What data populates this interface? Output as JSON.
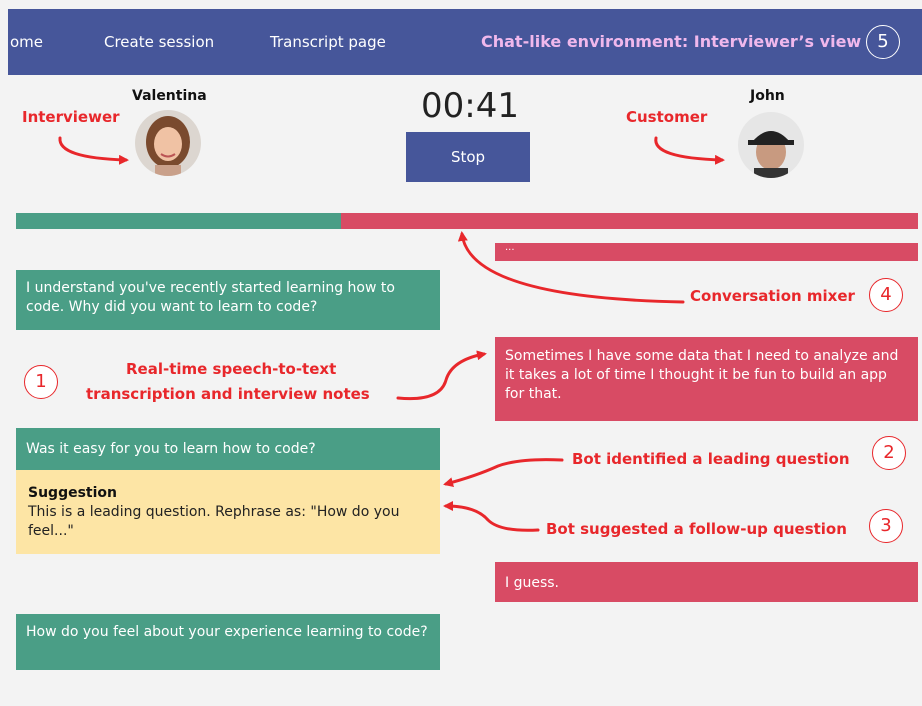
{
  "nav": {
    "items": [
      "ome",
      "Create session",
      "Transcript page"
    ],
    "title": "Chat-like environment: Interviewer’s view",
    "badge": "5"
  },
  "session": {
    "timer": "00:41",
    "stop_label": "Stop",
    "interviewer_name": "Valentina",
    "customer_name": "John"
  },
  "annotations": {
    "interviewer": "Interviewer",
    "customer": "Customer",
    "mixer": "Conversation mixer",
    "mixer_num": "4",
    "transcription_line1": "Real-time speech-to-text",
    "transcription_line2": "transcription and interview notes",
    "transcription_num": "1",
    "leading": "Bot identified a leading question",
    "leading_num": "2",
    "followup": "Bot suggested a follow-up question",
    "followup_num": "3"
  },
  "mixer": {
    "interviewer_share": 0.36
  },
  "chat": {
    "m1": "I understand you've recently started learning how to code. Why did you want to learn to code?",
    "m2": "Sometimes I have some data that I need to analyze and it takes a lot of time I thought it be fun to build an app for that.",
    "m3": "Was it easy for you to learn how to code?",
    "m4": "I guess.",
    "m5": "How  do you feel about your experience learning to code?",
    "top_partial": "..."
  },
  "suggestion": {
    "title": "Suggestion",
    "text": "This is a leading question. Rephrase as: \"How do you feel...\""
  },
  "colors": {
    "nav": "#46569a",
    "interviewer": "#4a9e86",
    "customer": "#d84b64",
    "suggestion": "#fde5a5",
    "annotation": "#e8272b"
  }
}
